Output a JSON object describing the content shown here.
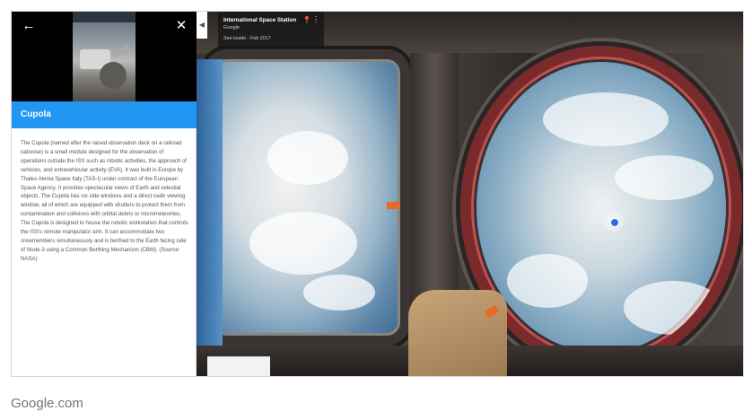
{
  "panel": {
    "title": "Cupola",
    "back_icon": "arrow-left-icon",
    "close_icon": "close-icon",
    "description": "The Cupola (named after the raised observation deck on a railroad caboose) is a small module designed for the observation of operations outside the ISS such as robotic activities, the approach of vehicles, and extravehicular activity (EVA). It was built in Europe by Thales Alenia Space Italy (TAS-I) under contract of the European Space Agency. It provides spectacular views of Earth and celestial objects. The Cupola has six side windows and a direct nadir viewing window, all of which are equipped with shutters to protect them from contamination and collisions with orbital debris or micrometeorites. The Cupola is designed to house the robotic workstation that controls the ISS's remote manipulator arm. It can accommodate two crewmembers simultaneously and is berthed to the Earth facing side of Node-3 using a Common Berthing Mechanism (CBM). (Source: NASA)"
  },
  "place_card": {
    "title": "International Space Station",
    "source": "Google",
    "date": "See inside - Feb 2017"
  },
  "caption": "Google.com",
  "colors": {
    "accent": "#2196f3",
    "nav_dot": "#2a6fe0"
  }
}
